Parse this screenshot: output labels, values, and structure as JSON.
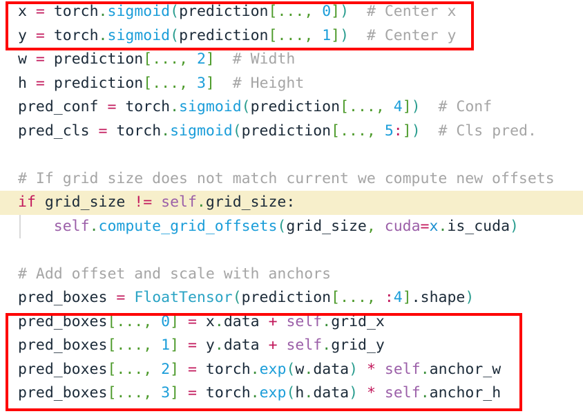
{
  "editor": {
    "language": "python",
    "background_color": "#ffffff",
    "default_text_color": "#1b2a38",
    "highlighted_line_color": "#f7efcb",
    "annotation_color": "#fe0000"
  },
  "annotations": [
    {
      "name": "center-xy-highlight",
      "label": "Center x / Center y computation box",
      "color": "#fe0000"
    },
    {
      "name": "pred-boxes-assignment-highlight",
      "label": "pred_boxes assignment box",
      "color": "#fe0000"
    }
  ],
  "lines": [
    {
      "n": 1,
      "text": "x = torch.sigmoid(prediction[..., 0])  # Center x",
      "tokens": [
        {
          "t": "x",
          "c": "tk-plain"
        },
        {
          "t": " ",
          "c": "tk-plain"
        },
        {
          "t": "=",
          "c": "tk-op"
        },
        {
          "t": " ",
          "c": "tk-plain"
        },
        {
          "t": "torch",
          "c": "tk-mod"
        },
        {
          "t": ".",
          "c": "tk-dot"
        },
        {
          "t": "sigmoid",
          "c": "tk-fn"
        },
        {
          "t": "(",
          "c": "tk-paren"
        },
        {
          "t": "prediction",
          "c": "tk-plain"
        },
        {
          "t": "[",
          "c": "tk-brk"
        },
        {
          "t": "...",
          "c": "tk-brk"
        },
        {
          "t": ",",
          "c": "tk-brk"
        },
        {
          "t": " ",
          "c": "tk-plain"
        },
        {
          "t": "0",
          "c": "tk-num"
        },
        {
          "t": "]",
          "c": "tk-brk"
        },
        {
          "t": ")",
          "c": "tk-paren"
        },
        {
          "t": "  ",
          "c": "tk-plain"
        },
        {
          "t": "# Center x",
          "c": "tk-cmt"
        }
      ]
    },
    {
      "n": 2,
      "text": "y = torch.sigmoid(prediction[..., 1])  # Center y",
      "tokens": [
        {
          "t": "y",
          "c": "tk-plain"
        },
        {
          "t": " ",
          "c": "tk-plain"
        },
        {
          "t": "=",
          "c": "tk-op"
        },
        {
          "t": " ",
          "c": "tk-plain"
        },
        {
          "t": "torch",
          "c": "tk-mod"
        },
        {
          "t": ".",
          "c": "tk-dot"
        },
        {
          "t": "sigmoid",
          "c": "tk-fn"
        },
        {
          "t": "(",
          "c": "tk-paren"
        },
        {
          "t": "prediction",
          "c": "tk-plain"
        },
        {
          "t": "[",
          "c": "tk-brk"
        },
        {
          "t": "...",
          "c": "tk-brk"
        },
        {
          "t": ",",
          "c": "tk-brk"
        },
        {
          "t": " ",
          "c": "tk-plain"
        },
        {
          "t": "1",
          "c": "tk-num"
        },
        {
          "t": "]",
          "c": "tk-brk"
        },
        {
          "t": ")",
          "c": "tk-paren"
        },
        {
          "t": "  ",
          "c": "tk-plain"
        },
        {
          "t": "# Center y",
          "c": "tk-cmt"
        }
      ]
    },
    {
      "n": 3,
      "text": "w = prediction[..., 2]  # Width",
      "tokens": [
        {
          "t": "w",
          "c": "tk-plain"
        },
        {
          "t": " ",
          "c": "tk-plain"
        },
        {
          "t": "=",
          "c": "tk-op"
        },
        {
          "t": " ",
          "c": "tk-plain"
        },
        {
          "t": "prediction",
          "c": "tk-plain"
        },
        {
          "t": "[",
          "c": "tk-brk"
        },
        {
          "t": "...",
          "c": "tk-brk"
        },
        {
          "t": ",",
          "c": "tk-brk"
        },
        {
          "t": " ",
          "c": "tk-plain"
        },
        {
          "t": "2",
          "c": "tk-num"
        },
        {
          "t": "]",
          "c": "tk-brk"
        },
        {
          "t": "  ",
          "c": "tk-plain"
        },
        {
          "t": "# Width",
          "c": "tk-cmt"
        }
      ]
    },
    {
      "n": 4,
      "text": "h = prediction[..., 3]  # Height",
      "tokens": [
        {
          "t": "h",
          "c": "tk-plain"
        },
        {
          "t": " ",
          "c": "tk-plain"
        },
        {
          "t": "=",
          "c": "tk-op"
        },
        {
          "t": " ",
          "c": "tk-plain"
        },
        {
          "t": "prediction",
          "c": "tk-plain"
        },
        {
          "t": "[",
          "c": "tk-brk"
        },
        {
          "t": "...",
          "c": "tk-brk"
        },
        {
          "t": ",",
          "c": "tk-brk"
        },
        {
          "t": " ",
          "c": "tk-plain"
        },
        {
          "t": "3",
          "c": "tk-num"
        },
        {
          "t": "]",
          "c": "tk-brk"
        },
        {
          "t": "  ",
          "c": "tk-plain"
        },
        {
          "t": "# Height",
          "c": "tk-cmt"
        }
      ]
    },
    {
      "n": 5,
      "text": "pred_conf = torch.sigmoid(prediction[..., 4])  # Conf",
      "tokens": [
        {
          "t": "pred_conf",
          "c": "tk-plain"
        },
        {
          "t": " ",
          "c": "tk-plain"
        },
        {
          "t": "=",
          "c": "tk-op"
        },
        {
          "t": " ",
          "c": "tk-plain"
        },
        {
          "t": "torch",
          "c": "tk-mod"
        },
        {
          "t": ".",
          "c": "tk-dot"
        },
        {
          "t": "sigmoid",
          "c": "tk-fn"
        },
        {
          "t": "(",
          "c": "tk-paren"
        },
        {
          "t": "prediction",
          "c": "tk-plain"
        },
        {
          "t": "[",
          "c": "tk-brk"
        },
        {
          "t": "...",
          "c": "tk-brk"
        },
        {
          "t": ",",
          "c": "tk-brk"
        },
        {
          "t": " ",
          "c": "tk-plain"
        },
        {
          "t": "4",
          "c": "tk-num"
        },
        {
          "t": "]",
          "c": "tk-brk"
        },
        {
          "t": ")",
          "c": "tk-paren"
        },
        {
          "t": "  ",
          "c": "tk-plain"
        },
        {
          "t": "# Conf",
          "c": "tk-cmt"
        }
      ]
    },
    {
      "n": 6,
      "text": "pred_cls = torch.sigmoid(prediction[..., 5:])  # Cls pred.",
      "tokens": [
        {
          "t": "pred_cls",
          "c": "tk-plain"
        },
        {
          "t": " ",
          "c": "tk-plain"
        },
        {
          "t": "=",
          "c": "tk-op"
        },
        {
          "t": " ",
          "c": "tk-plain"
        },
        {
          "t": "torch",
          "c": "tk-mod"
        },
        {
          "t": ".",
          "c": "tk-dot"
        },
        {
          "t": "sigmoid",
          "c": "tk-fn"
        },
        {
          "t": "(",
          "c": "tk-paren"
        },
        {
          "t": "prediction",
          "c": "tk-plain"
        },
        {
          "t": "[",
          "c": "tk-brk"
        },
        {
          "t": "...",
          "c": "tk-brk"
        },
        {
          "t": ",",
          "c": "tk-brk"
        },
        {
          "t": " ",
          "c": "tk-plain"
        },
        {
          "t": "5",
          "c": "tk-num"
        },
        {
          "t": ":",
          "c": "tk-op"
        },
        {
          "t": "]",
          "c": "tk-brk"
        },
        {
          "t": ")",
          "c": "tk-paren"
        },
        {
          "t": "  ",
          "c": "tk-plain"
        },
        {
          "t": "# Cls pred.",
          "c": "tk-cmt"
        }
      ]
    },
    {
      "n": 7,
      "text": "",
      "tokens": []
    },
    {
      "n": 8,
      "text": "# If grid size does not match current we compute new offsets",
      "tokens": [
        {
          "t": "# If grid size does not match current we compute new offsets",
          "c": "tk-cmt"
        }
      ]
    },
    {
      "n": 9,
      "text": "if grid_size != self.grid_size:",
      "highlighted": true,
      "tokens": [
        {
          "t": "if",
          "c": "tk-kw"
        },
        {
          "t": " ",
          "c": "tk-plain"
        },
        {
          "t": "grid_size",
          "c": "tk-plain"
        },
        {
          "t": " ",
          "c": "tk-plain"
        },
        {
          "t": "!=",
          "c": "tk-op"
        },
        {
          "t": " ",
          "c": "tk-plain"
        },
        {
          "t": "self",
          "c": "tk-self"
        },
        {
          "t": ".",
          "c": "tk-dot"
        },
        {
          "t": "grid_size",
          "c": "tk-plain"
        },
        {
          "t": ":",
          "c": "tk-plain"
        }
      ]
    },
    {
      "n": 10,
      "text": "    self.compute_grid_offsets(grid_size, cuda=x.is_cuda)",
      "indent_guide": true,
      "tokens": [
        {
          "t": "    ",
          "c": "tk-plain"
        },
        {
          "t": "self",
          "c": "tk-self"
        },
        {
          "t": ".",
          "c": "tk-dot"
        },
        {
          "t": "compute_grid_offsets",
          "c": "tk-fn"
        },
        {
          "t": "(",
          "c": "tk-paren"
        },
        {
          "t": "grid_size",
          "c": "tk-plain"
        },
        {
          "t": ",",
          "c": "tk-brk"
        },
        {
          "t": " ",
          "c": "tk-plain"
        },
        {
          "t": "cuda",
          "c": "tk-self"
        },
        {
          "t": "=",
          "c": "tk-op"
        },
        {
          "t": "x",
          "c": "tk-var"
        },
        {
          "t": ".",
          "c": "tk-dot"
        },
        {
          "t": "is_cuda",
          "c": "tk-plain"
        },
        {
          "t": ")",
          "c": "tk-paren"
        }
      ]
    },
    {
      "n": 11,
      "text": "",
      "tokens": []
    },
    {
      "n": 12,
      "text": "# Add offset and scale with anchors",
      "tokens": [
        {
          "t": "# Add offset and scale with anchors",
          "c": "tk-cmt"
        }
      ]
    },
    {
      "n": 13,
      "text": "pred_boxes = FloatTensor(prediction[..., :4].shape)",
      "tokens": [
        {
          "t": "pred_boxes",
          "c": "tk-plain"
        },
        {
          "t": " ",
          "c": "tk-plain"
        },
        {
          "t": "=",
          "c": "tk-op"
        },
        {
          "t": " ",
          "c": "tk-plain"
        },
        {
          "t": "FloatTensor",
          "c": "tk-cls"
        },
        {
          "t": "(",
          "c": "tk-paren"
        },
        {
          "t": "prediction",
          "c": "tk-plain"
        },
        {
          "t": "[",
          "c": "tk-brk"
        },
        {
          "t": "...",
          "c": "tk-brk"
        },
        {
          "t": ",",
          "c": "tk-brk"
        },
        {
          "t": " ",
          "c": "tk-plain"
        },
        {
          "t": ":",
          "c": "tk-op"
        },
        {
          "t": "4",
          "c": "tk-num"
        },
        {
          "t": "]",
          "c": "tk-brk"
        },
        {
          "t": ".",
          "c": "tk-plain"
        },
        {
          "t": "shape",
          "c": "tk-plain"
        },
        {
          "t": ")",
          "c": "tk-paren"
        }
      ]
    },
    {
      "n": 14,
      "text": "pred_boxes[..., 0] = x.data + self.grid_x",
      "tokens": [
        {
          "t": "pred_boxes",
          "c": "tk-plain"
        },
        {
          "t": "[",
          "c": "tk-brk"
        },
        {
          "t": "...",
          "c": "tk-brk"
        },
        {
          "t": ",",
          "c": "tk-brk"
        },
        {
          "t": " ",
          "c": "tk-plain"
        },
        {
          "t": "0",
          "c": "tk-num"
        },
        {
          "t": "]",
          "c": "tk-brk"
        },
        {
          "t": " ",
          "c": "tk-plain"
        },
        {
          "t": "=",
          "c": "tk-op"
        },
        {
          "t": " ",
          "c": "tk-plain"
        },
        {
          "t": "x",
          "c": "tk-plain"
        },
        {
          "t": ".",
          "c": "tk-dot"
        },
        {
          "t": "data",
          "c": "tk-plain"
        },
        {
          "t": " ",
          "c": "tk-plain"
        },
        {
          "t": "+",
          "c": "tk-op"
        },
        {
          "t": " ",
          "c": "tk-plain"
        },
        {
          "t": "self",
          "c": "tk-self"
        },
        {
          "t": ".",
          "c": "tk-dot"
        },
        {
          "t": "grid_x",
          "c": "tk-plain"
        }
      ]
    },
    {
      "n": 15,
      "text": "pred_boxes[..., 1] = y.data + self.grid_y",
      "tokens": [
        {
          "t": "pred_boxes",
          "c": "tk-plain"
        },
        {
          "t": "[",
          "c": "tk-brk"
        },
        {
          "t": "...",
          "c": "tk-brk"
        },
        {
          "t": ",",
          "c": "tk-brk"
        },
        {
          "t": " ",
          "c": "tk-plain"
        },
        {
          "t": "1",
          "c": "tk-num"
        },
        {
          "t": "]",
          "c": "tk-brk"
        },
        {
          "t": " ",
          "c": "tk-plain"
        },
        {
          "t": "=",
          "c": "tk-op"
        },
        {
          "t": " ",
          "c": "tk-plain"
        },
        {
          "t": "y",
          "c": "tk-plain"
        },
        {
          "t": ".",
          "c": "tk-dot"
        },
        {
          "t": "data",
          "c": "tk-plain"
        },
        {
          "t": " ",
          "c": "tk-plain"
        },
        {
          "t": "+",
          "c": "tk-op"
        },
        {
          "t": " ",
          "c": "tk-plain"
        },
        {
          "t": "self",
          "c": "tk-self"
        },
        {
          "t": ".",
          "c": "tk-dot"
        },
        {
          "t": "grid_y",
          "c": "tk-plain"
        }
      ]
    },
    {
      "n": 16,
      "text": "pred_boxes[..., 2] = torch.exp(w.data) * self.anchor_w",
      "tokens": [
        {
          "t": "pred_boxes",
          "c": "tk-plain"
        },
        {
          "t": "[",
          "c": "tk-brk"
        },
        {
          "t": "...",
          "c": "tk-brk"
        },
        {
          "t": ",",
          "c": "tk-brk"
        },
        {
          "t": " ",
          "c": "tk-plain"
        },
        {
          "t": "2",
          "c": "tk-num"
        },
        {
          "t": "]",
          "c": "tk-brk"
        },
        {
          "t": " ",
          "c": "tk-plain"
        },
        {
          "t": "=",
          "c": "tk-op"
        },
        {
          "t": " ",
          "c": "tk-plain"
        },
        {
          "t": "torch",
          "c": "tk-mod"
        },
        {
          "t": ".",
          "c": "tk-dot"
        },
        {
          "t": "exp",
          "c": "tk-fn"
        },
        {
          "t": "(",
          "c": "tk-paren"
        },
        {
          "t": "w",
          "c": "tk-plain"
        },
        {
          "t": ".",
          "c": "tk-dot"
        },
        {
          "t": "data",
          "c": "tk-plain"
        },
        {
          "t": ")",
          "c": "tk-paren"
        },
        {
          "t": " ",
          "c": "tk-plain"
        },
        {
          "t": "*",
          "c": "tk-op"
        },
        {
          "t": " ",
          "c": "tk-plain"
        },
        {
          "t": "self",
          "c": "tk-self"
        },
        {
          "t": ".",
          "c": "tk-dot"
        },
        {
          "t": "anchor_w",
          "c": "tk-plain"
        }
      ]
    },
    {
      "n": 17,
      "text": "pred_boxes[..., 3] = torch.exp(h.data) * self.anchor_h",
      "tokens": [
        {
          "t": "pred_boxes",
          "c": "tk-plain"
        },
        {
          "t": "[",
          "c": "tk-brk"
        },
        {
          "t": "...",
          "c": "tk-brk"
        },
        {
          "t": ",",
          "c": "tk-brk"
        },
        {
          "t": " ",
          "c": "tk-plain"
        },
        {
          "t": "3",
          "c": "tk-num"
        },
        {
          "t": "]",
          "c": "tk-brk"
        },
        {
          "t": " ",
          "c": "tk-plain"
        },
        {
          "t": "=",
          "c": "tk-op"
        },
        {
          "t": " ",
          "c": "tk-plain"
        },
        {
          "t": "torch",
          "c": "tk-mod"
        },
        {
          "t": ".",
          "c": "tk-dot"
        },
        {
          "t": "exp",
          "c": "tk-fn"
        },
        {
          "t": "(",
          "c": "tk-paren"
        },
        {
          "t": "h",
          "c": "tk-plain"
        },
        {
          "t": ".",
          "c": "tk-dot"
        },
        {
          "t": "data",
          "c": "tk-plain"
        },
        {
          "t": ")",
          "c": "tk-paren"
        },
        {
          "t": " ",
          "c": "tk-plain"
        },
        {
          "t": "*",
          "c": "tk-op"
        },
        {
          "t": " ",
          "c": "tk-plain"
        },
        {
          "t": "self",
          "c": "tk-self"
        },
        {
          "t": ".",
          "c": "tk-dot"
        },
        {
          "t": "anchor_h",
          "c": "tk-plain"
        }
      ]
    }
  ]
}
